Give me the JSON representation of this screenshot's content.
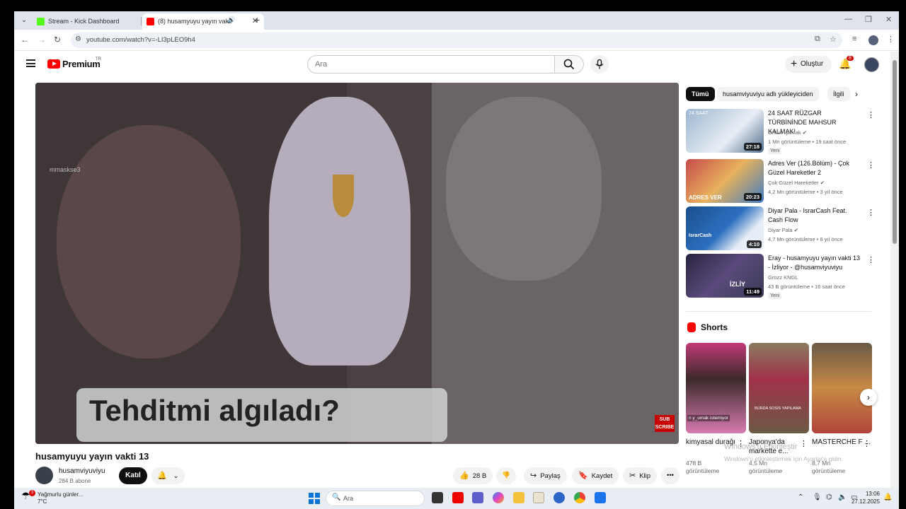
{
  "browser": {
    "tabs": [
      {
        "title": "Stream - Kick Dashboard",
        "active": false
      },
      {
        "title": "(8) husamyuyu yayın vakti 1",
        "active": true
      }
    ],
    "url": "youtube.com/watch?v=-LI3pLEO9h4"
  },
  "header": {
    "logo_text": "Premium",
    "logo_region": "TR",
    "search_placeholder": "Ara",
    "create_label": "Oluştur",
    "notification_count": "8"
  },
  "video": {
    "watermark": "mmaskse3",
    "caption": "Tehditmi algıladı?",
    "subscribe_badge_line1": "SUB",
    "subscribe_badge_line2": "SCRIBE",
    "title": "husamyuyu yayın vakti 13",
    "channel": "husamviyuviyu",
    "subscribers": "284 B abone",
    "join_label": "Katıl",
    "likes": "28 B",
    "share_label": "Paylaş",
    "save_label": "Kaydet",
    "clip_label": "Klip"
  },
  "chips": [
    "Tümü",
    "husamviyuviyu adlı yükleyiciden",
    "İlgili"
  ],
  "recommendations": [
    {
      "title": "24 SAAT RÜZGAR TÜRBİNİNDE MAHSUR KALMAK!",
      "channel": "Orkun Işıtmak",
      "verified": true,
      "views": "1 Mn görüntüleme",
      "age": "19 saat önce",
      "badge": "Yeni",
      "duration": "27:18",
      "thumb_text": "24 SAAT"
    },
    {
      "title": "Adres Ver (126.Bölüm) - Çok Güzel Hareketler 2",
      "channel": "Çok Güzel Hareketler",
      "verified": true,
      "views": "4,2 Mn görüntüleme",
      "age": "3 yıl önce",
      "badge": "",
      "duration": "20:23",
      "thumb_text": "ADRES VER"
    },
    {
      "title": "Diyar Pala - IsrarCash Feat. Cash Flow",
      "channel": "Diyar Pala",
      "verified": true,
      "views": "4,7 Mn görüntüleme",
      "age": "8 yıl önce",
      "badge": "",
      "duration": "4:10",
      "thumb_text": "IsrarCash"
    },
    {
      "title": "Eray - husamyuyu yayın vakti 13 - İzliyor - @husamviyuviyu",
      "channel": "Grozz KNGL",
      "verified": false,
      "views": "43 B görüntüleme",
      "age": "16 saat önce",
      "badge": "Yeni",
      "duration": "11:49",
      "thumb_text": "İZLİY"
    }
  ],
  "shorts": {
    "title": "Shorts",
    "items": [
      {
        "title": "kimyasal durağı",
        "views_line1": "478 B",
        "views_line2": "görüntüleme",
        "overlay": "n y_umak istemiyor"
      },
      {
        "title": "Japonya'da markette e...",
        "views_line1": "4,5 Mn",
        "views_line2": "görüntüleme",
        "overlay": "BURDA SOSIS YAPILAMA"
      },
      {
        "title": "MASTERCHE F ...",
        "views_line1": "8,7 Mn",
        "views_line2": "görüntüleme",
        "overlay": ""
      }
    ]
  },
  "activation": {
    "line1": "Windows'u Etkinleştir",
    "line2": "Windows'u etkinleştirmek için Ayarlar'a gidin."
  },
  "taskbar": {
    "weather_badge": "3",
    "weather_title": "Yağmurlu günler...",
    "weather_temp": "7°C",
    "search_placeholder": "Ara",
    "time": "13:06",
    "date": "27.12.2025"
  }
}
